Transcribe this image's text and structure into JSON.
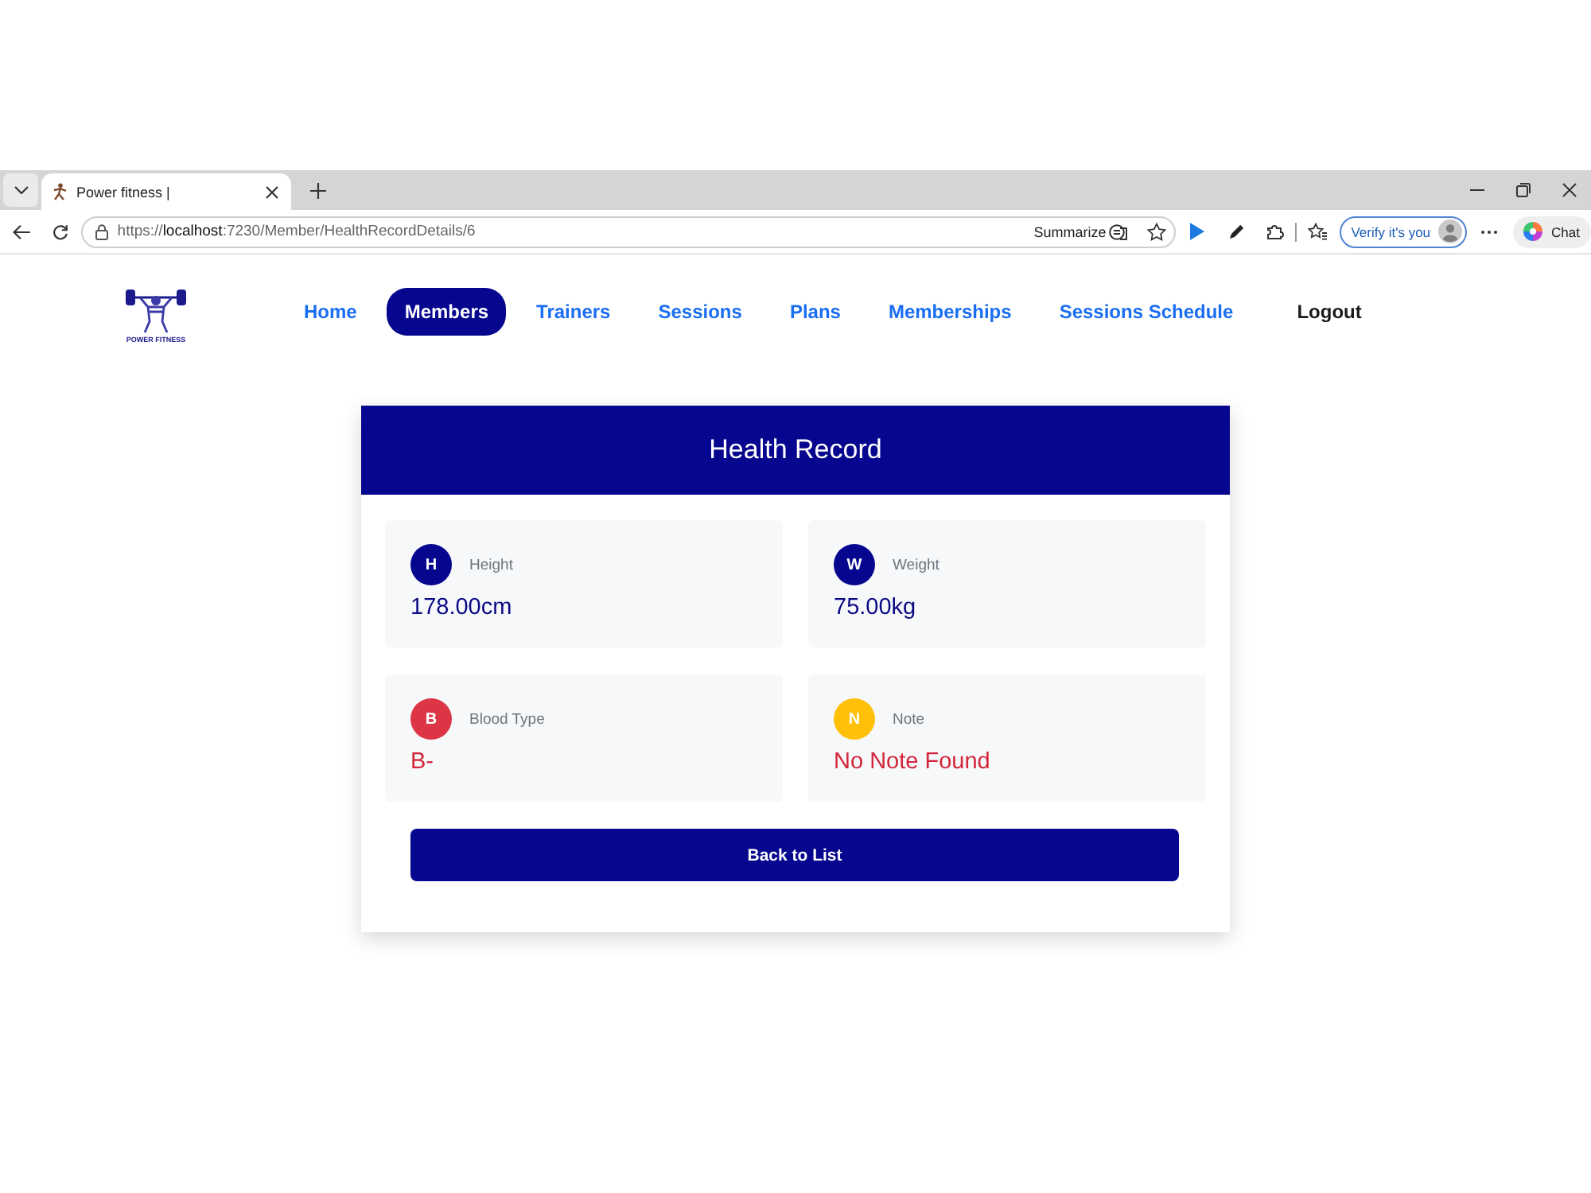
{
  "browser": {
    "tab": {
      "title": "Power fitness |"
    },
    "address": "https://**localhost**:7230/Member/HealthRecordDetails/6",
    "summarize": "Summarize",
    "profile_button": "Verify it's you",
    "chat": "Chat"
  },
  "nav": {
    "logo_text": "POWER FITNESS",
    "items": [
      {
        "label": "Home",
        "kind": "link",
        "selected": false
      },
      {
        "label": "Members",
        "kind": "link",
        "selected": true
      },
      {
        "label": "Trainers",
        "kind": "link",
        "selected": false
      },
      {
        "label": "Sessions",
        "kind": "link",
        "selected": false
      },
      {
        "label": "Plans",
        "kind": "link",
        "selected": false
      },
      {
        "label": "Memberships",
        "kind": "link",
        "selected": false
      },
      {
        "label": "Sessions Schedule",
        "kind": "link",
        "selected": false
      },
      {
        "label": "Logout",
        "kind": "logout",
        "selected": false
      }
    ]
  },
  "record": {
    "title": "Health Record",
    "fields": [
      {
        "kind": "measurement",
        "initial": "H",
        "label": "Height",
        "value": "178.00cm",
        "color": "#06068f"
      },
      {
        "kind": "measurement",
        "initial": "W",
        "label": "Weight",
        "value": "75.00kg",
        "color": "#06068f"
      },
      {
        "kind": "alert",
        "initial": "B",
        "label": "Blood Type",
        "value": "B-",
        "color": "#dc3545"
      },
      {
        "kind": "alert",
        "initial": "N",
        "label": "Note",
        "value": "No Note Found",
        "color": "#ffc107"
      }
    ],
    "button": "Back to List"
  }
}
